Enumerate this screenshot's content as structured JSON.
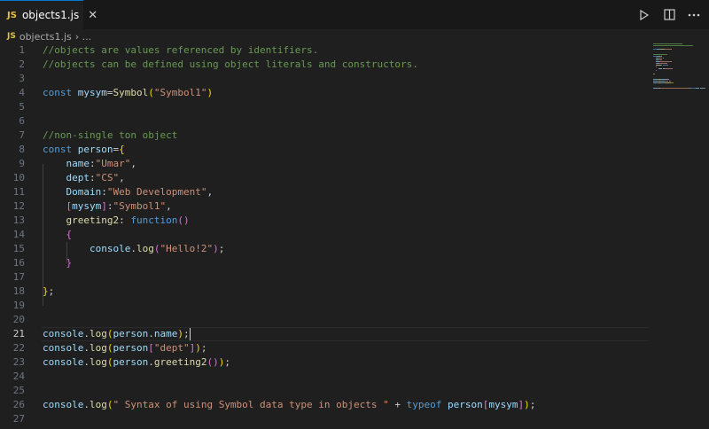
{
  "tab": {
    "badge": "JS",
    "title": "objects1.js",
    "close": "✕"
  },
  "breadcrumb": {
    "badge": "JS",
    "file": "objects1.js",
    "sep": "› ..."
  },
  "actions": [
    "run-icon",
    "split-editor-icon",
    "more-icon"
  ],
  "colors": {
    "accent": "#0078d4",
    "comment": "#6a9955",
    "keyword": "#569cd6",
    "string": "#ce9178",
    "variable": "#9cdcfe",
    "function": "#dcdcaa"
  },
  "editor": {
    "active_line": 21,
    "lines": [
      {
        "n": "1",
        "t": [
          [
            "cm",
            "//objects are values referenced by identifiers."
          ]
        ]
      },
      {
        "n": "2",
        "t": [
          [
            "cm",
            "//objects can be defined using object literals and constructors."
          ]
        ]
      },
      {
        "n": "3",
        "t": []
      },
      {
        "n": "4",
        "t": [
          [
            "kw",
            "const "
          ],
          [
            "var",
            "mysym"
          ],
          [
            "p",
            "="
          ],
          [
            "fn",
            "Symbol"
          ],
          [
            "b1",
            "("
          ],
          [
            "str",
            "\"Symbol1\""
          ],
          [
            "b1",
            ")"
          ]
        ]
      },
      {
        "n": "5",
        "t": []
      },
      {
        "n": "6",
        "t": []
      },
      {
        "n": "7",
        "t": [
          [
            "cm",
            "//non-single ton object"
          ]
        ]
      },
      {
        "n": "8",
        "t": [
          [
            "kw",
            "const "
          ],
          [
            "var",
            "person"
          ],
          [
            "p",
            "="
          ],
          [
            "b1",
            "{"
          ]
        ]
      },
      {
        "n": "9",
        "t": [
          [
            "p",
            "    "
          ],
          [
            "var",
            "name"
          ],
          [
            "p",
            ":"
          ],
          [
            "str",
            "\"Umar\""
          ],
          [
            "p",
            ","
          ]
        ]
      },
      {
        "n": "10",
        "t": [
          [
            "p",
            "    "
          ],
          [
            "var",
            "dept"
          ],
          [
            "p",
            ":"
          ],
          [
            "str",
            "\"CS\""
          ],
          [
            "p",
            ","
          ]
        ]
      },
      {
        "n": "11",
        "t": [
          [
            "p",
            "    "
          ],
          [
            "var",
            "Domain"
          ],
          [
            "p",
            ":"
          ],
          [
            "str",
            "\"Web Development\""
          ],
          [
            "p",
            ","
          ]
        ]
      },
      {
        "n": "12",
        "t": [
          [
            "p",
            "    "
          ],
          [
            "b2",
            "["
          ],
          [
            "var",
            "mysym"
          ],
          [
            "b2",
            "]"
          ],
          [
            "p",
            ":"
          ],
          [
            "str",
            "\"Symbol1\""
          ],
          [
            "p",
            ","
          ]
        ]
      },
      {
        "n": "13",
        "t": [
          [
            "p",
            "    "
          ],
          [
            "fn",
            "greeting2"
          ],
          [
            "p",
            ": "
          ],
          [
            "kw",
            "function"
          ],
          [
            "b2",
            "()"
          ]
        ]
      },
      {
        "n": "14",
        "t": [
          [
            "p",
            "    "
          ],
          [
            "b2",
            "{"
          ]
        ]
      },
      {
        "n": "15",
        "t": [
          [
            "p",
            "        "
          ],
          [
            "var",
            "console"
          ],
          [
            "p",
            "."
          ],
          [
            "fn",
            "log"
          ],
          [
            "b2",
            "("
          ],
          [
            "str",
            "\"Hello!2\""
          ],
          [
            "b2",
            ")"
          ],
          [
            "p",
            ";"
          ]
        ]
      },
      {
        "n": "16",
        "t": [
          [
            "p",
            "    "
          ],
          [
            "b2",
            "}"
          ]
        ]
      },
      {
        "n": "17",
        "t": []
      },
      {
        "n": "18",
        "t": [
          [
            "b1",
            "}"
          ],
          [
            "p",
            ";"
          ]
        ]
      },
      {
        "n": "19",
        "t": []
      },
      {
        "n": "20",
        "t": []
      },
      {
        "n": "21",
        "t": [
          [
            "var",
            "console"
          ],
          [
            "p",
            "."
          ],
          [
            "fn",
            "log"
          ],
          [
            "b1",
            "("
          ],
          [
            "var",
            "person"
          ],
          [
            "p",
            "."
          ],
          [
            "var",
            "name"
          ],
          [
            "b1",
            ")"
          ],
          [
            "p",
            ";"
          ]
        ]
      },
      {
        "n": "22",
        "t": [
          [
            "var",
            "console"
          ],
          [
            "p",
            "."
          ],
          [
            "fn",
            "log"
          ],
          [
            "b1",
            "("
          ],
          [
            "var",
            "person"
          ],
          [
            "b2",
            "["
          ],
          [
            "str",
            "\"dept\""
          ],
          [
            "b2",
            "]"
          ],
          [
            "b1",
            ")"
          ],
          [
            "p",
            ";"
          ]
        ]
      },
      {
        "n": "23",
        "t": [
          [
            "var",
            "console"
          ],
          [
            "p",
            "."
          ],
          [
            "fn",
            "log"
          ],
          [
            "b1",
            "("
          ],
          [
            "var",
            "person"
          ],
          [
            "p",
            "."
          ],
          [
            "fn",
            "greeting2"
          ],
          [
            "b2",
            "()"
          ],
          [
            "b1",
            ")"
          ],
          [
            "p",
            ";"
          ]
        ]
      },
      {
        "n": "24",
        "t": []
      },
      {
        "n": "25",
        "t": []
      },
      {
        "n": "26",
        "t": [
          [
            "var",
            "console"
          ],
          [
            "p",
            "."
          ],
          [
            "fn",
            "log"
          ],
          [
            "b1",
            "("
          ],
          [
            "str",
            "\" Syntax of using Symbol data type in objects \""
          ],
          [
            "p",
            " + "
          ],
          [
            "kw",
            "typeof "
          ],
          [
            "var",
            "person"
          ],
          [
            "b2",
            "["
          ],
          [
            "var",
            "mysym"
          ],
          [
            "b2",
            "]"
          ],
          [
            "b1",
            ")"
          ],
          [
            "p",
            ";"
          ]
        ]
      },
      {
        "n": "27",
        "t": []
      }
    ]
  }
}
